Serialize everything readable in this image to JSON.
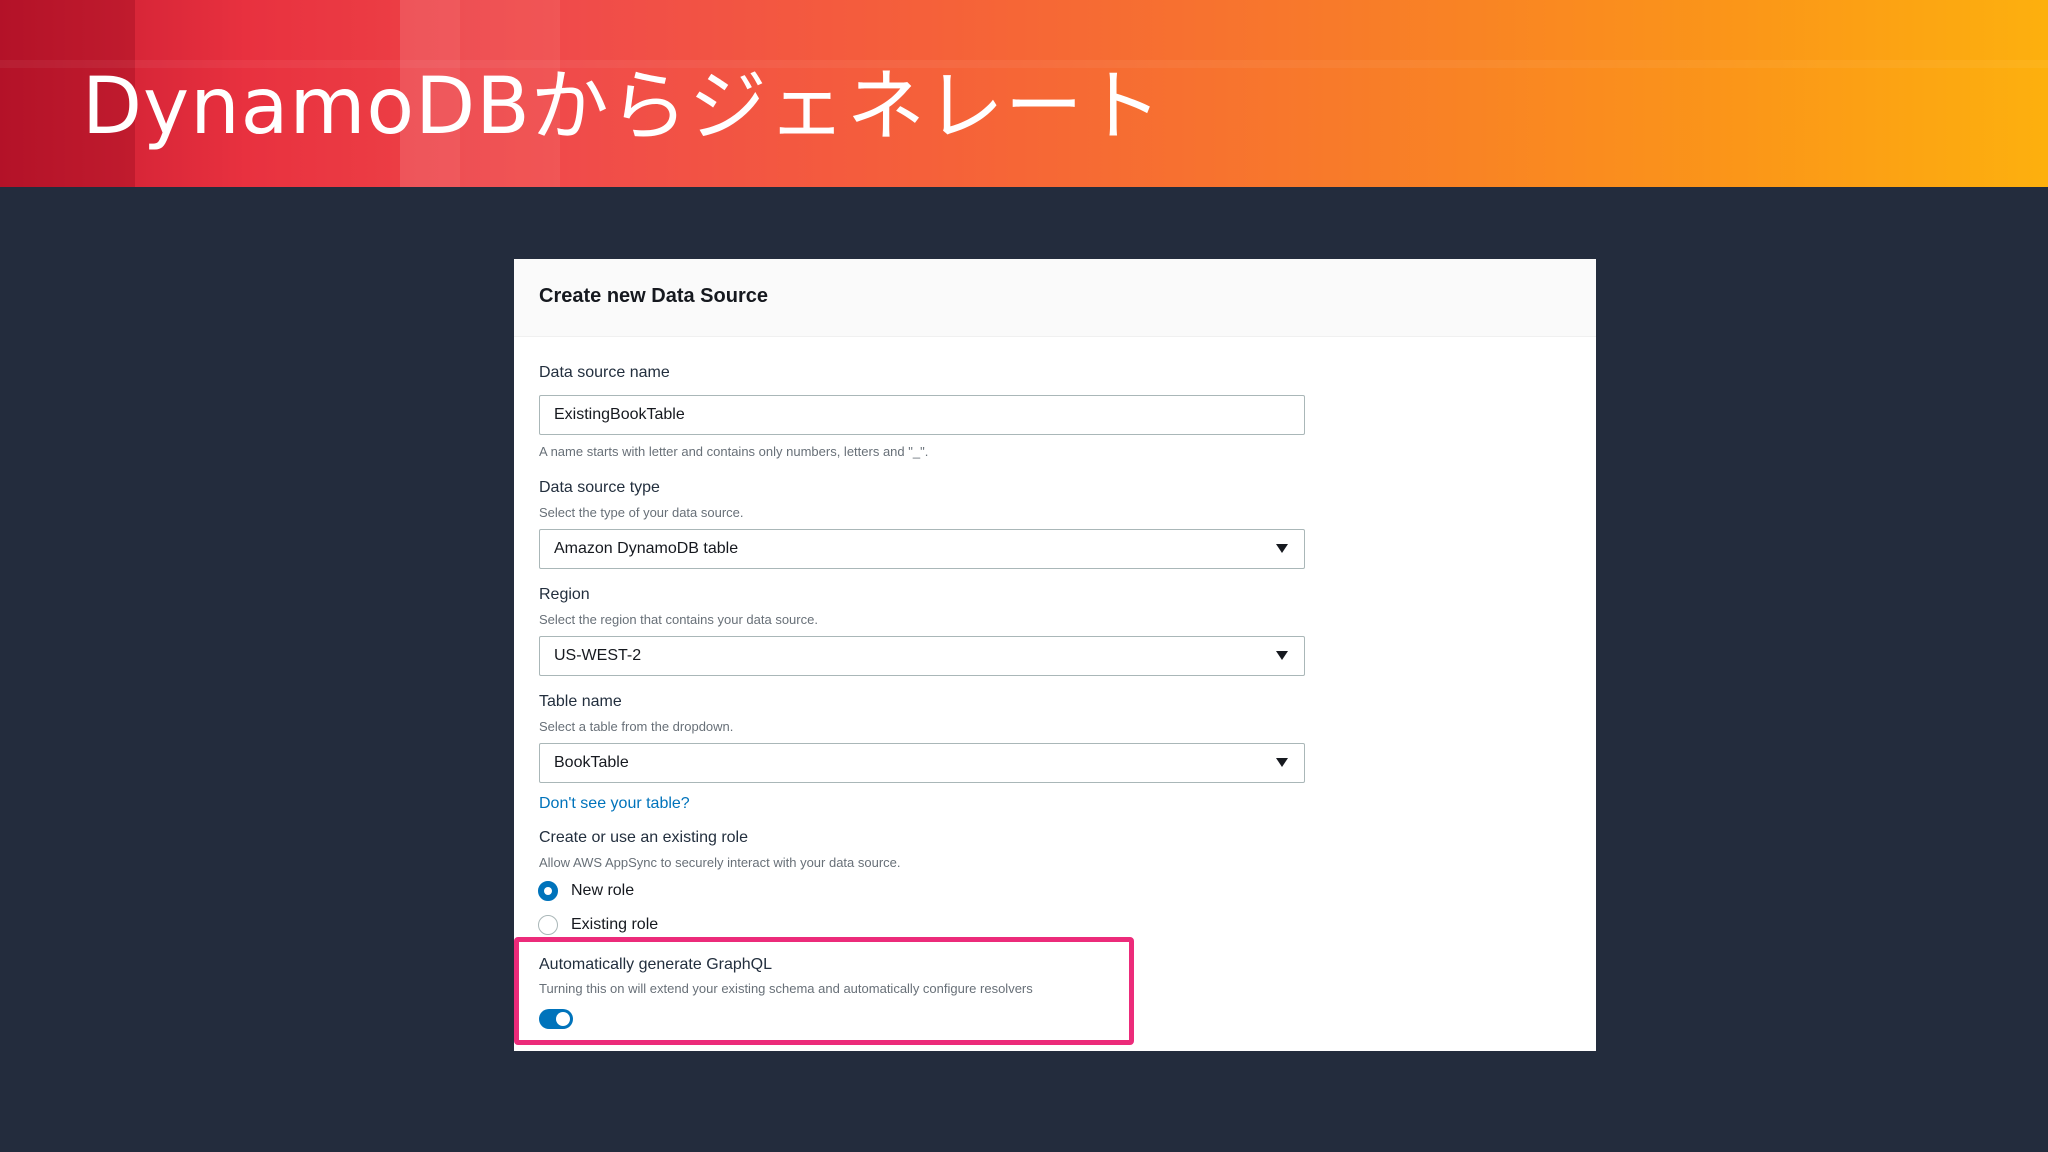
{
  "slide": {
    "title": "DynamoDBからジェネレート"
  },
  "form": {
    "title": "Create new Data Source",
    "data_source_name": {
      "label": "Data source name",
      "value": "ExistingBookTable",
      "hint": "A name starts with letter and contains only numbers, letters and \"_\"."
    },
    "data_source_type": {
      "label": "Data source type",
      "description": "Select the type of your data source.",
      "value": "Amazon DynamoDB table"
    },
    "region": {
      "label": "Region",
      "description": "Select the region that contains your data source.",
      "value": "US-WEST-2"
    },
    "table_name": {
      "label": "Table name",
      "description": "Select a table from the dropdown.",
      "value": "BookTable"
    },
    "missing_table_link": "Don't see your table?",
    "role": {
      "label": "Create or use an existing role",
      "description": "Allow AWS AppSync to securely interact with your data source.",
      "options": [
        {
          "label": "New role",
          "selected": true
        },
        {
          "label": "Existing role",
          "selected": false
        }
      ]
    },
    "auto_generate": {
      "label": "Automatically generate GraphQL",
      "description": "Turning this on will extend your existing schema and automatically configure resolvers",
      "enabled": true
    }
  },
  "colors": {
    "accent": "#0073bb",
    "highlight": "#ec2b7a",
    "background": "#232c3d"
  }
}
